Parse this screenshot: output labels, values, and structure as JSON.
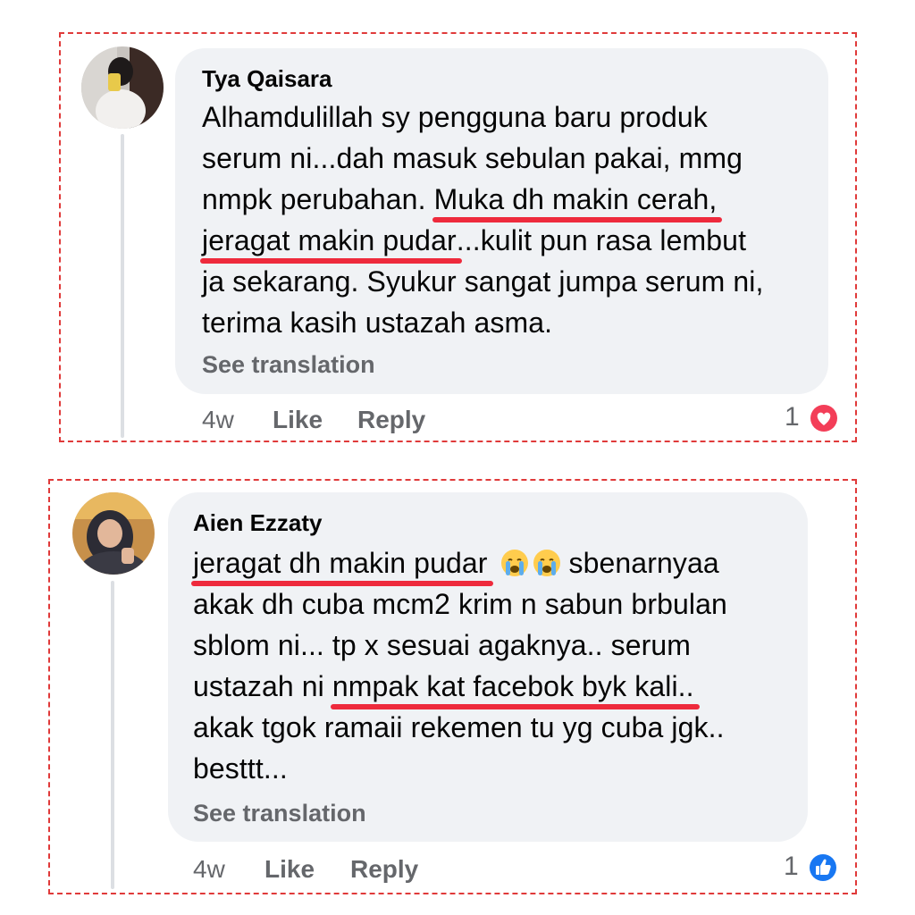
{
  "comments": [
    {
      "author": "Tya Qaisara",
      "lines": [
        {
          "parts": [
            {
              "text": "Alhamdulillah sy pengguna baru produk"
            }
          ]
        },
        {
          "parts": [
            {
              "text": "serum ni...dah masuk sebulan pakai, mmg"
            }
          ]
        },
        {
          "parts": [
            {
              "text": "nmpk perubahan. "
            },
            {
              "text": "Muka dh makin cerah,",
              "underline": true
            }
          ]
        },
        {
          "parts": [
            {
              "text": "jeragat makin pudar",
              "underline": true
            },
            {
              "text": "...kulit pun rasa lembut"
            }
          ]
        },
        {
          "parts": [
            {
              "text": "ja sekarang. Syukur sangat jumpa serum ni,"
            }
          ]
        },
        {
          "parts": [
            {
              "text": "terima kasih ustazah asma."
            }
          ]
        }
      ],
      "see_translation": "See translation",
      "time": "4w",
      "like_label": "Like",
      "reply_label": "Reply",
      "reaction_count": "1",
      "reaction_type": "love",
      "reaction_color": "#f33e58"
    },
    {
      "author": "Aien Ezzaty",
      "lines": [
        {
          "parts": [
            {
              "text": "jeragat dh makin pudar",
              "underline": true
            },
            {
              "emoji": "crying-face"
            },
            {
              "emoji": "crying-face"
            },
            {
              "text": " sbenarnyaa"
            }
          ]
        },
        {
          "parts": [
            {
              "text": "akak dh cuba mcm2 krim n sabun brbulan"
            }
          ]
        },
        {
          "parts": [
            {
              "text": "sblom ni... tp x sesuai agaknya.. serum"
            }
          ]
        },
        {
          "parts": [
            {
              "text": "ustazah ni "
            },
            {
              "text": "nmpak kat facebok byk kali..",
              "underline": true
            }
          ]
        },
        {
          "parts": [
            {
              "text": "akak tgok ramaii rekemen tu yg cuba jgk.."
            }
          ]
        },
        {
          "parts": [
            {
              "text": "besttt..."
            }
          ]
        }
      ],
      "see_translation": "See translation",
      "time": "4w",
      "like_label": "Like",
      "reply_label": "Reply",
      "reaction_count": "1",
      "reaction_type": "like",
      "reaction_color": "#1877f2"
    }
  ],
  "highlight_color": "#ee2a3c",
  "frame_color": "#e03a3a"
}
